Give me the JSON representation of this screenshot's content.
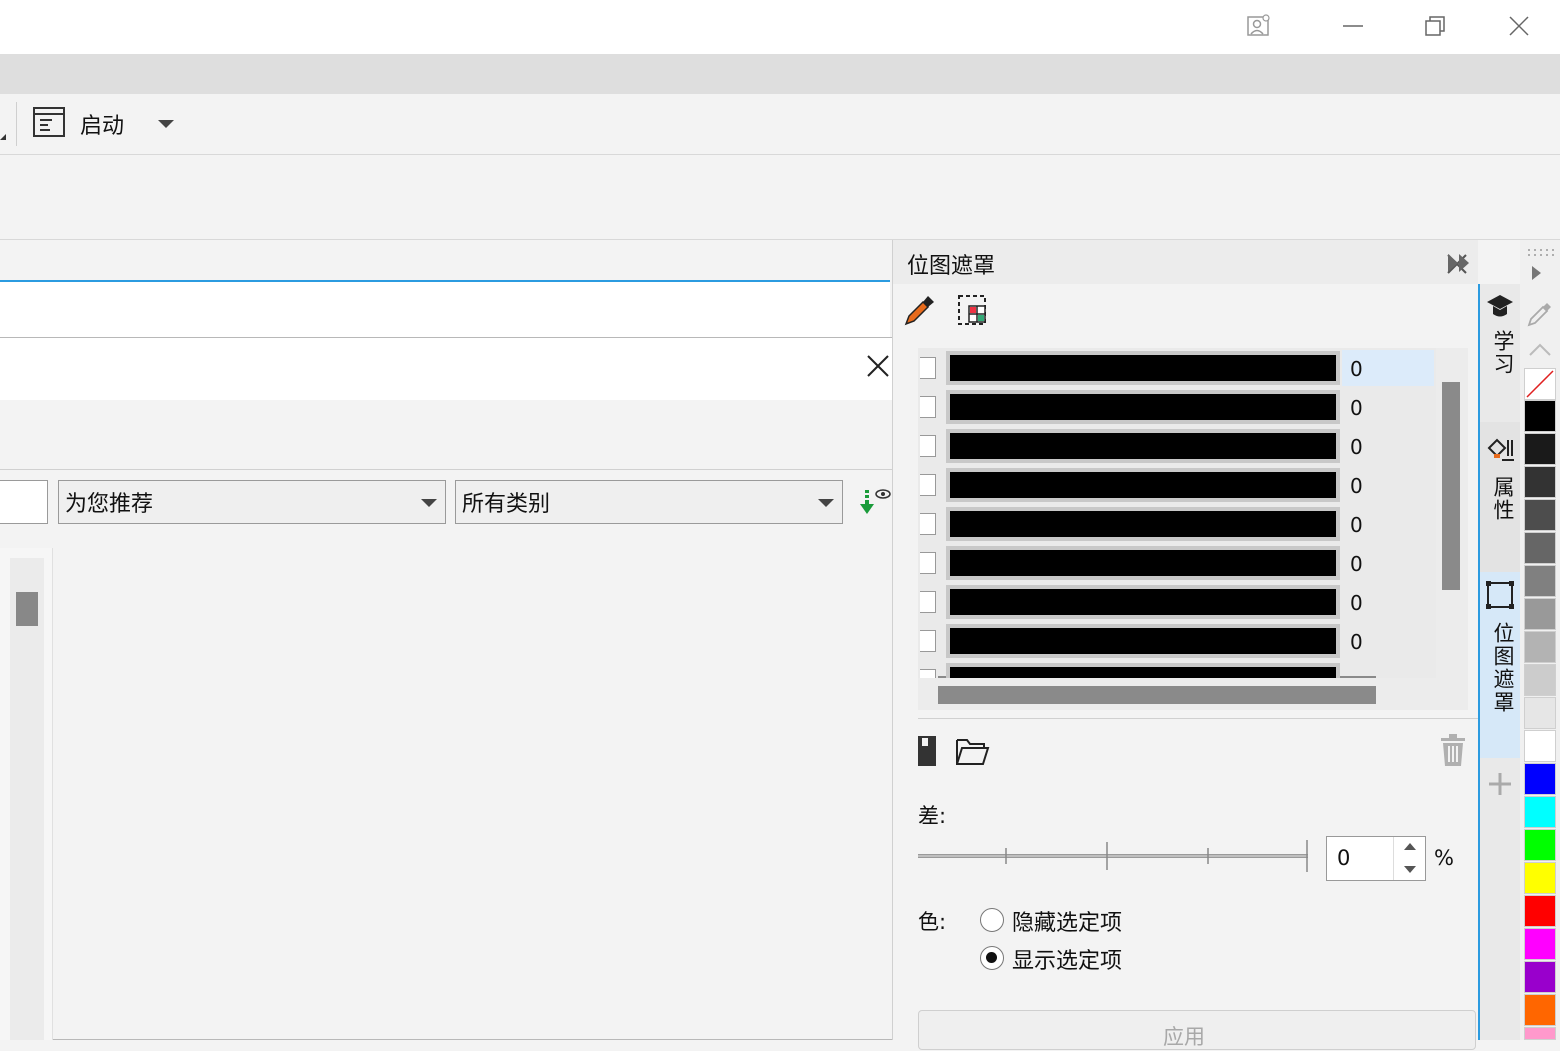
{
  "toolbar": {
    "launch_label": "启动"
  },
  "dialog": {
    "dropdown_recommend": "为您推荐",
    "dropdown_categories": "所有类别"
  },
  "docker": {
    "title": "位图遮罩",
    "rows": [
      "0",
      "0",
      "0",
      "0",
      "0",
      "0",
      "0",
      "0"
    ],
    "tolerance_label": "差:",
    "tolerance_value": "0",
    "percent": "%",
    "color_label": "色:",
    "radio_hide": "隐藏选定项",
    "radio_show": "显示选定项",
    "apply_label": "应用"
  },
  "sidetabs": {
    "learn": "学习",
    "properties": "属性",
    "bitmap_mask": "位图遮罩"
  },
  "palette": {
    "colors": [
      "#000000",
      "#1a1a1a",
      "#333333",
      "#4d4d4d",
      "#666666",
      "#808080",
      "#999999",
      "#b3b3b3",
      "#cccccc",
      "#e6e6e6",
      "#ffffff",
      "#0000ff",
      "#00ffff",
      "#00ff00",
      "#ffff00",
      "#ff0000",
      "#ff00ff",
      "#9900cc",
      "#ff6600",
      "#ff99cc"
    ]
  }
}
